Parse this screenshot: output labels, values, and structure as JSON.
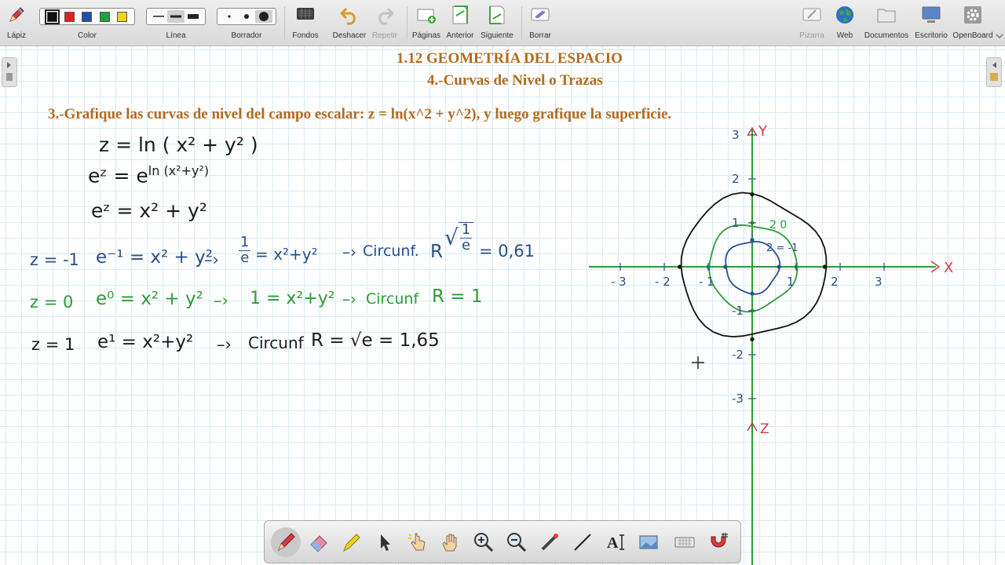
{
  "toolbar": {
    "pencil": "Lápiz",
    "color": "Color",
    "line": "Línea",
    "eraser": "Borrador",
    "backgrounds": "Fondos",
    "undo": "Deshacer",
    "redo": "Repetir",
    "pages": "Páginas",
    "previous": "Anterior",
    "next": "Siguiente",
    "clear": "Borrar",
    "board": "Pizarra",
    "web": "Web",
    "documents": "Documentos",
    "desktop": "Escritorio",
    "openboard": "OpenBoard",
    "colors": [
      "#111111",
      "#e02020",
      "#1f4fa8",
      "#22a03c",
      "#f0d020"
    ]
  },
  "board": {
    "title": "1.12 GEOMETRÍA DEL ESPACIO",
    "subtitle": "4.-Curvas de Nivel o Trazas",
    "problem": "3.-Grafique las curvas de nivel del campo escalar: z = ln(x^2 + y^2),  y luego grafique la superficie.",
    "eq1": "z = ln ( x² + y² )",
    "eq2_lhs": "eᶻ = e",
    "eq2_exp": "ln (x²+y²)",
    "eq3": "eᶻ = x² + y²",
    "row1": {
      "z": "z = -1",
      "expr": "e⁻¹ = x² + y²",
      "arrow": "–›",
      "frac_num": "1",
      "frac_den": "e",
      "rhs": "= x²+y²",
      "arrow2": "–›",
      "circ": "Circunf.",
      "R": "R",
      "sqrt_num": "1",
      "sqrt_den": "e",
      "val": "= 0,61"
    },
    "row2": {
      "z": "z = 0",
      "expr": "e⁰ = x² + y²",
      "arrow": "–›",
      "rhs": "1 = x²+y²",
      "arrow2": "–›",
      "circ": "Circunf",
      "R": "R = 1"
    },
    "row3": {
      "z": "z = 1",
      "expr": "e¹ = x²+y²",
      "arrow": "–›",
      "circ": "Circunf",
      "R": "R = √e = 1,65"
    },
    "graph": {
      "axis_x": "X",
      "axis_y": "Y",
      "axis_z": "Z",
      "x_ticks": [
        "- 3",
        "- 2",
        "- 1",
        "1",
        "2",
        "3"
      ],
      "y_ticks": [
        "3",
        "2",
        "1",
        "-1",
        "-2",
        "-3"
      ],
      "level_labels": [
        "2 = -1",
        "2 0"
      ],
      "level_radii": [
        0.61,
        1,
        1.65
      ],
      "colors": {
        "axis": "#2f9a36",
        "labels": "#d23a4a",
        "blue": "#2a4e8a",
        "green": "#2f9a36",
        "black": "#111111"
      }
    }
  }
}
